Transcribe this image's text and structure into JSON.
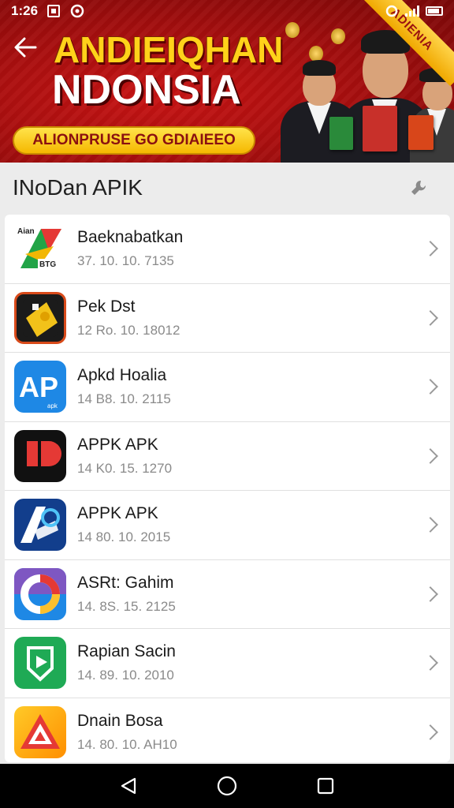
{
  "status_bar": {
    "time": "1:26"
  },
  "banner": {
    "title": "ANDIEIQHAN",
    "subtitle": "NDONSIA",
    "pill_text": "ALIONPRUSE GO GDIAIEEO",
    "ribbon_text": "ADIENIA",
    "accent_color": "#c81414",
    "gold_color": "#ffd21a"
  },
  "header": {
    "title": "INoDan APIK"
  },
  "apps": [
    {
      "name": "Baeknabatkan",
      "meta": "37. 10. 10. 7135",
      "icon": "arrow-logo-icon"
    },
    {
      "name": "Pek Dst",
      "meta": "12 Ro. 10. 18012",
      "icon": "ticket-icon"
    },
    {
      "name": "Apkd Hoalia",
      "meta": "14 B8. 10. 2115",
      "icon": "ap-logo-icon"
    },
    {
      "name": "APPK APK",
      "meta": "14 K0. 15. 1270",
      "icon": "flag-icon"
    },
    {
      "name": "APPK APK",
      "meta": "14 80. 10. 2015",
      "icon": "ap-dark-logo-icon"
    },
    {
      "name": "ASRt: Gahim",
      "meta": "14. 8S. 15. 2125",
      "icon": "ring-logo-icon"
    },
    {
      "name": "Rapian Sacin",
      "meta": "14. 89. 10. 2010",
      "icon": "play-badge-icon"
    },
    {
      "name": "Dnain Bosa",
      "meta": "14. 80. 10. AH10",
      "icon": "triangle-logo-icon"
    }
  ]
}
